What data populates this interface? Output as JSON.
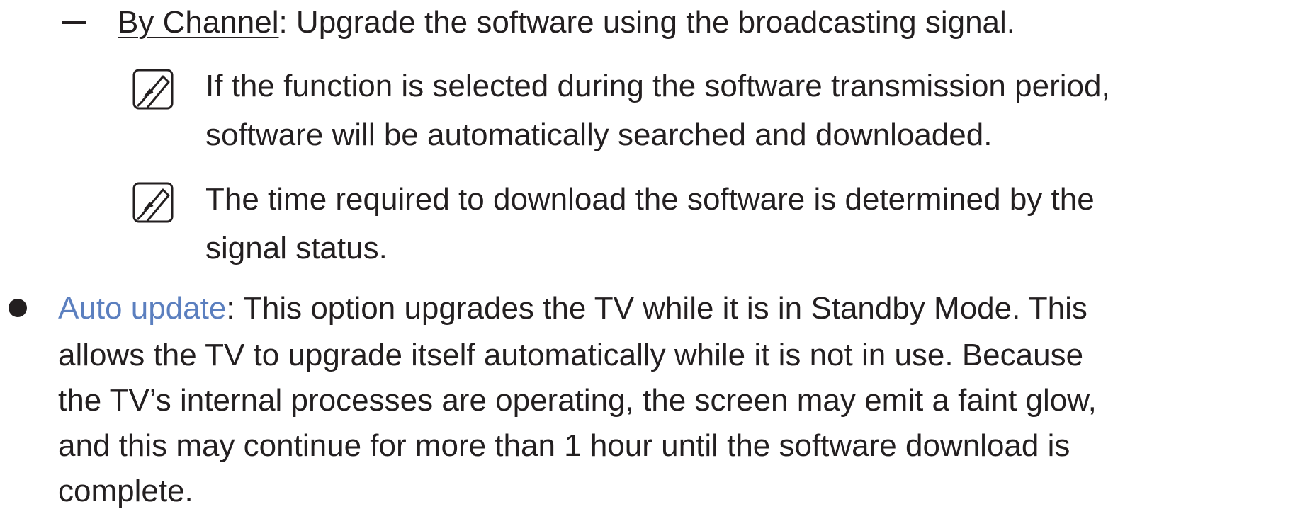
{
  "subitem": {
    "term": "By Channel",
    "text": ": Upgrade the software using the broadcasting signal."
  },
  "notes": [
    {
      "icon": "note-icon",
      "line1": "If the function is selected during the software transmission period,",
      "line2": "software will be automatically searched and downloaded."
    },
    {
      "icon": "note-icon",
      "line1": "The time required to download the software is determined by the",
      "line2": "signal status."
    }
  ],
  "bullet": {
    "term": "Auto update",
    "line1": ": This option upgrades the TV while it is in Standby Mode. This",
    "line2": "allows the TV to upgrade itself automatically while it is not in use. Because",
    "line3": "the TV’s internal processes are operating, the screen may emit a faint glow,",
    "line4": "and this may continue for more than 1 hour until the software download is",
    "line5": "complete."
  },
  "colors": {
    "text": "#231f20",
    "accent": "#5b7fbf"
  }
}
